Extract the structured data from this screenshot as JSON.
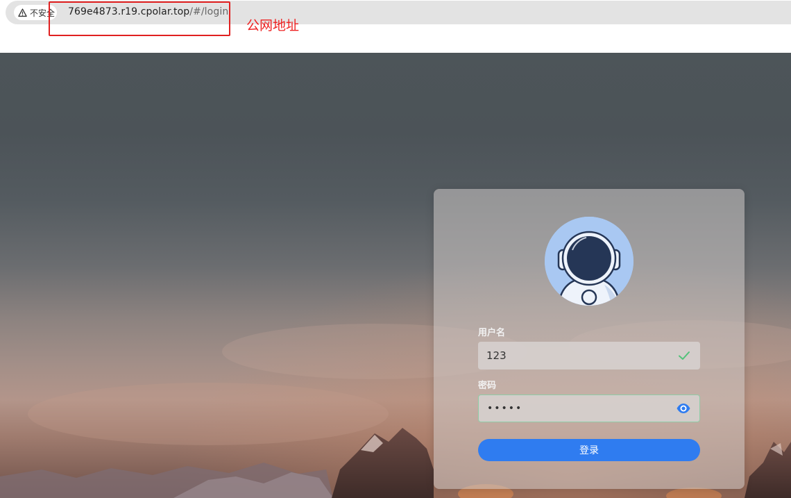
{
  "browser": {
    "security_label": "不安全",
    "url_host": "769e4873.r19.cpolar.top",
    "url_path": "/#/login",
    "annotation_label": "公网地址"
  },
  "login": {
    "username_label": "用户名",
    "username_value": "123",
    "password_label": "密码",
    "password_value": "•••••",
    "submit_label": "登录"
  },
  "colors": {
    "accent": "#2f7cf0",
    "success": "#52c27a",
    "annotation": "#e02020"
  },
  "icons": {
    "security": "warning-triangle-icon",
    "username_status": "check-icon",
    "password_toggle": "eye-icon"
  }
}
